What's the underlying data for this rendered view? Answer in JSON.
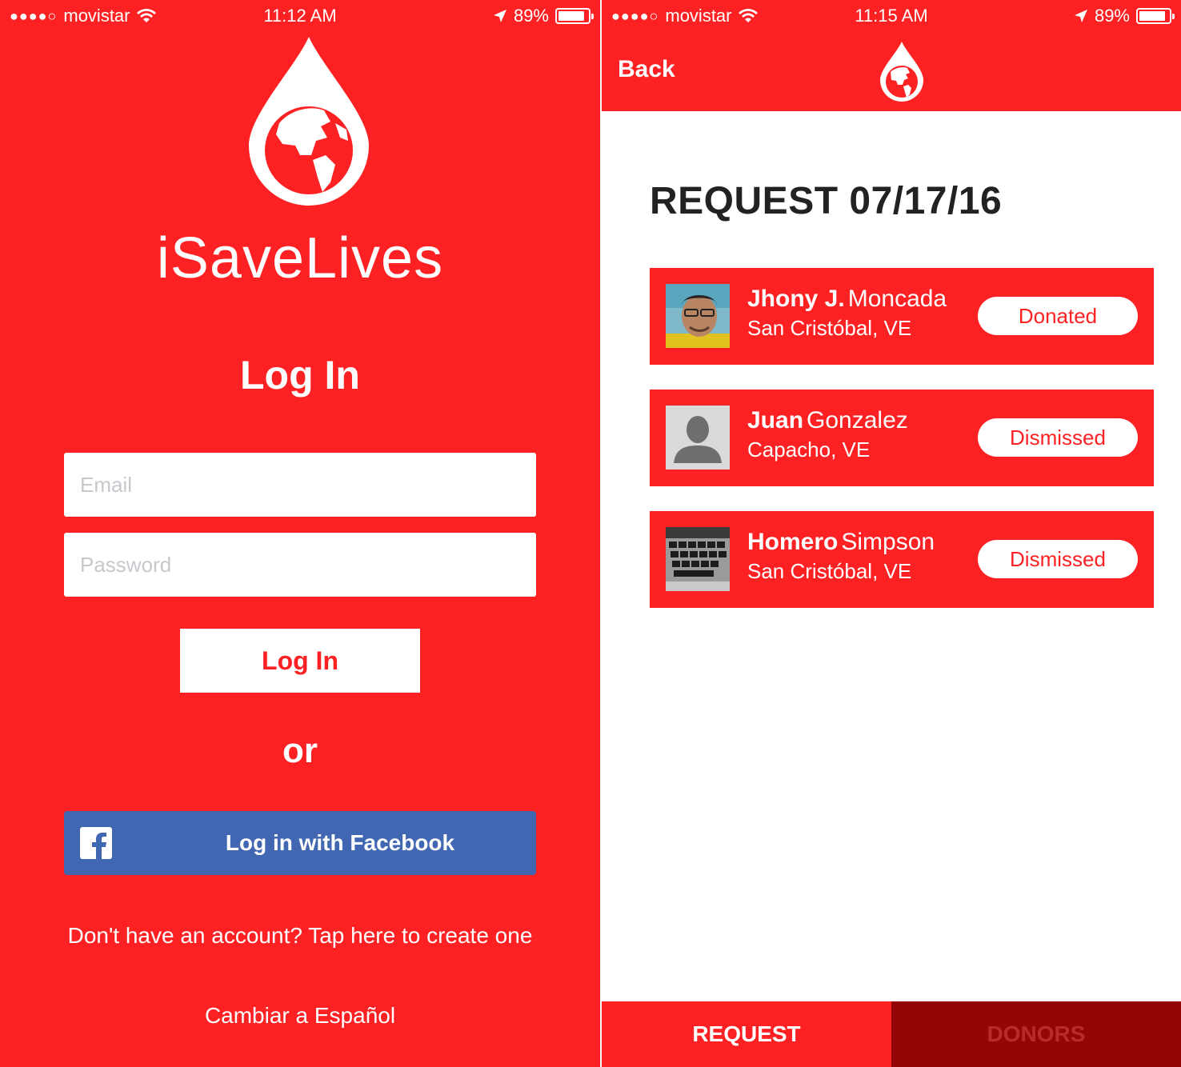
{
  "colors": {
    "brand_red": "#fe2123",
    "facebook_blue": "#4267b2",
    "tab_inactive": "#960505"
  },
  "left_screen": {
    "status_bar": {
      "signal": "●●●●○",
      "carrier": "movistar",
      "time": "11:12 AM",
      "battery": "89%",
      "battery_level": 0.89
    },
    "app_name": "iSaveLives",
    "title": "Log In",
    "email_placeholder": "Email",
    "password_placeholder": "Password",
    "login_button": "Log In",
    "or_label": "or",
    "facebook_button": "Log in with Facebook",
    "signup_link": "Don't have an account? Tap here to create one",
    "language_link": "Cambiar a Español"
  },
  "right_screen": {
    "status_bar": {
      "signal": "●●●●○",
      "carrier": "movistar",
      "time": "11:15 AM",
      "battery": "89%",
      "battery_level": 0.89
    },
    "back_label": "Back",
    "request_title": "REQUEST 07/17/16",
    "donors": [
      {
        "first": "Jhony J.",
        "last": "Moncada",
        "location": "San Cristóbal, VE",
        "status": "Donated",
        "avatar": "person-photo"
      },
      {
        "first": "Juan",
        "last": "Gonzalez",
        "location": "Capacho, VE",
        "status": "Dismissed",
        "avatar": "default-user-silhouette"
      },
      {
        "first": "Homero",
        "last": "Simpson",
        "location": "San Cristóbal, VE",
        "status": "Dismissed",
        "avatar": "keyboard-photo"
      }
    ],
    "tabs": [
      {
        "label": "REQUEST",
        "active": true
      },
      {
        "label": "DONORS",
        "active": false
      }
    ]
  }
}
